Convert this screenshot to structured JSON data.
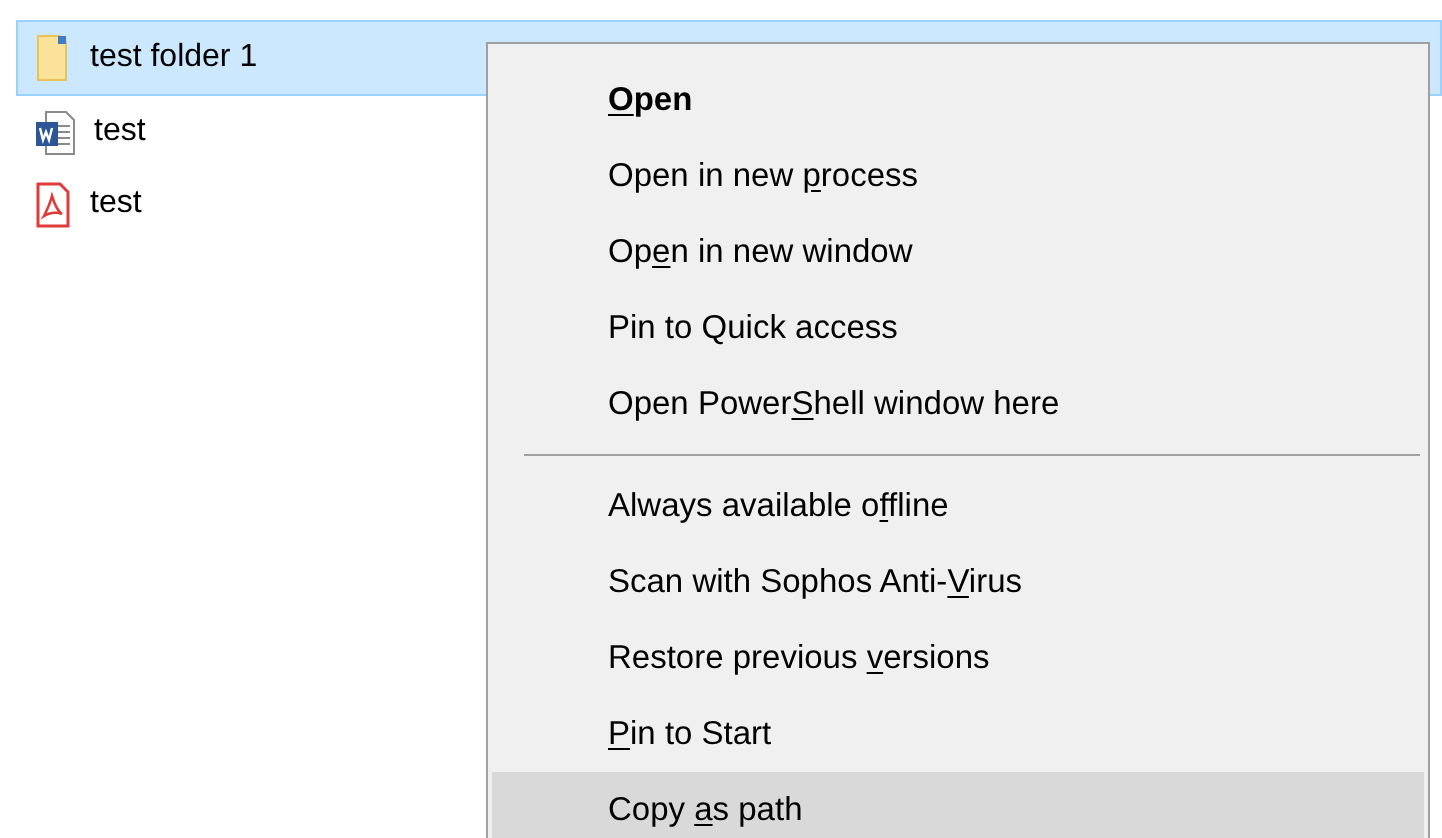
{
  "files": [
    {
      "name": "test folder 1",
      "kind": "folder",
      "selected": true
    },
    {
      "name": "test",
      "kind": "word",
      "selected": false
    },
    {
      "name": "test",
      "kind": "pdf",
      "selected": false
    }
  ],
  "context_menu": {
    "groups": [
      [
        {
          "key": "O",
          "after": "pen",
          "default": true,
          "highlighted": false
        },
        {
          "before": "Open in new ",
          "key": "p",
          "after": "rocess",
          "default": false,
          "highlighted": false
        },
        {
          "before": "Op",
          "key": "e",
          "after": "n in new window",
          "default": false,
          "highlighted": false
        },
        {
          "before": "Pin to Quick access",
          "default": false,
          "highlighted": false
        },
        {
          "before": "Open Power",
          "key": "S",
          "after": "hell window here",
          "default": false,
          "highlighted": false
        }
      ],
      [
        {
          "before": "Always available o",
          "key": "f",
          "after": "fline",
          "default": false,
          "highlighted": false
        },
        {
          "before": "Scan with Sophos Anti-",
          "key": "V",
          "after": "irus",
          "default": false,
          "highlighted": false
        },
        {
          "before": "Restore previous ",
          "key": "v",
          "after": "ersions",
          "default": false,
          "highlighted": false
        },
        {
          "key": "P",
          "after": "in to Start",
          "default": false,
          "highlighted": false
        },
        {
          "before": "Copy ",
          "key": "a",
          "after": "s path",
          "default": false,
          "highlighted": true
        }
      ]
    ]
  }
}
